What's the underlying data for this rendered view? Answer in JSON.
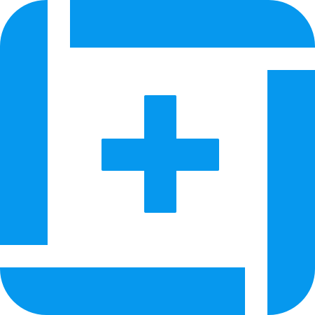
{
  "icon": {
    "name": "add-frame-icon",
    "accent_color": "#0698EE",
    "background_color": "#FFFFFF"
  }
}
